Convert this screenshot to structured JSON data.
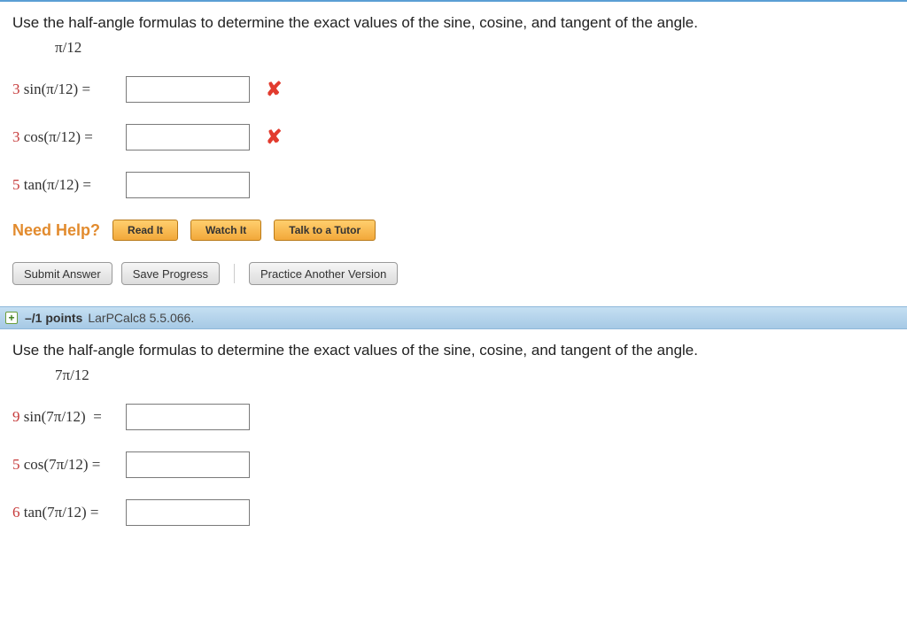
{
  "q1": {
    "prompt": "Use the half-angle formulas to determine the exact values of the sine, cosine, and tangent of the angle.",
    "angle": "π/12",
    "rows": [
      {
        "attempts": "3",
        "func": "sin(π/12)",
        "value": "",
        "wrong": true
      },
      {
        "attempts": "3",
        "func": "cos(π/12)",
        "value": "",
        "wrong": true
      },
      {
        "attempts": "5",
        "func": "tan(π/12)",
        "value": "",
        "wrong": false
      }
    ],
    "help_label": "Need Help?",
    "help_buttons": {
      "read": "Read It",
      "watch": "Watch It",
      "tutor": "Talk to a Tutor"
    },
    "actions": {
      "submit": "Submit Answer",
      "save": "Save Progress",
      "practice": "Practice Another Version"
    }
  },
  "divider": {
    "expand": "+",
    "points": "–/1 points",
    "ref": "LarPCalc8 5.5.066."
  },
  "q2": {
    "prompt": "Use the half-angle formulas to determine the exact values of the sine, cosine, and tangent of the angle.",
    "angle": "7π/12",
    "rows": [
      {
        "attempts": "9",
        "func": "sin(7π/12)",
        "value": ""
      },
      {
        "attempts": "5",
        "func": "cos(7π/12)",
        "value": ""
      },
      {
        "attempts": "6",
        "func": "tan(7π/12)",
        "value": ""
      }
    ]
  }
}
